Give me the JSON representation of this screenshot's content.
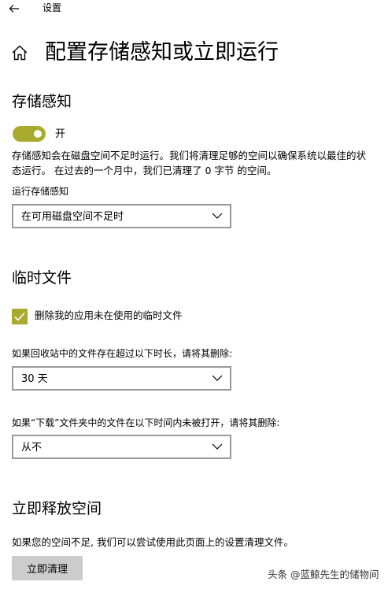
{
  "window": {
    "title": "设置"
  },
  "page": {
    "title": "配置存储感知或立即运行"
  },
  "storage_sense": {
    "heading": "存储感知",
    "toggle_state": "开",
    "description": "存储感知会在磁盘空间不足时运行。我们将清理足够的空间以确保系统以最佳的状态运行。 在过去的一个月中，我们已清理了 0 字节 的空间。",
    "run_label": "运行存储感知",
    "run_selected": "在可用磁盘空间不足时"
  },
  "temp_files": {
    "heading": "临时文件",
    "checkbox_label": "删除我的应用未在使用的临时文件",
    "checkbox_checked": true,
    "recycle_label": "如果回收站中的文件存在超过以下时长，请将其删除:",
    "recycle_selected": "30 天",
    "downloads_label": "如果“下载”文件夹中的文件在以下时间内未被打开，请将其删除:",
    "downloads_selected": "从不"
  },
  "free_space": {
    "heading": "立即释放空间",
    "description": "如果您的空间不足, 我们可以尝试使用此页面上的设置清理文件。",
    "button_label": "立即清理"
  },
  "watermark": {
    "text": "头条 @蓝鲸先生的储物间"
  },
  "colors": {
    "accent": "#a8ab2e",
    "dropdown_border": "#999999",
    "button_bg": "#cccccc"
  },
  "icons": {
    "back": "back-arrow-icon",
    "home": "home-icon",
    "chevron": "chevron-down-icon",
    "check": "checkmark-icon"
  }
}
